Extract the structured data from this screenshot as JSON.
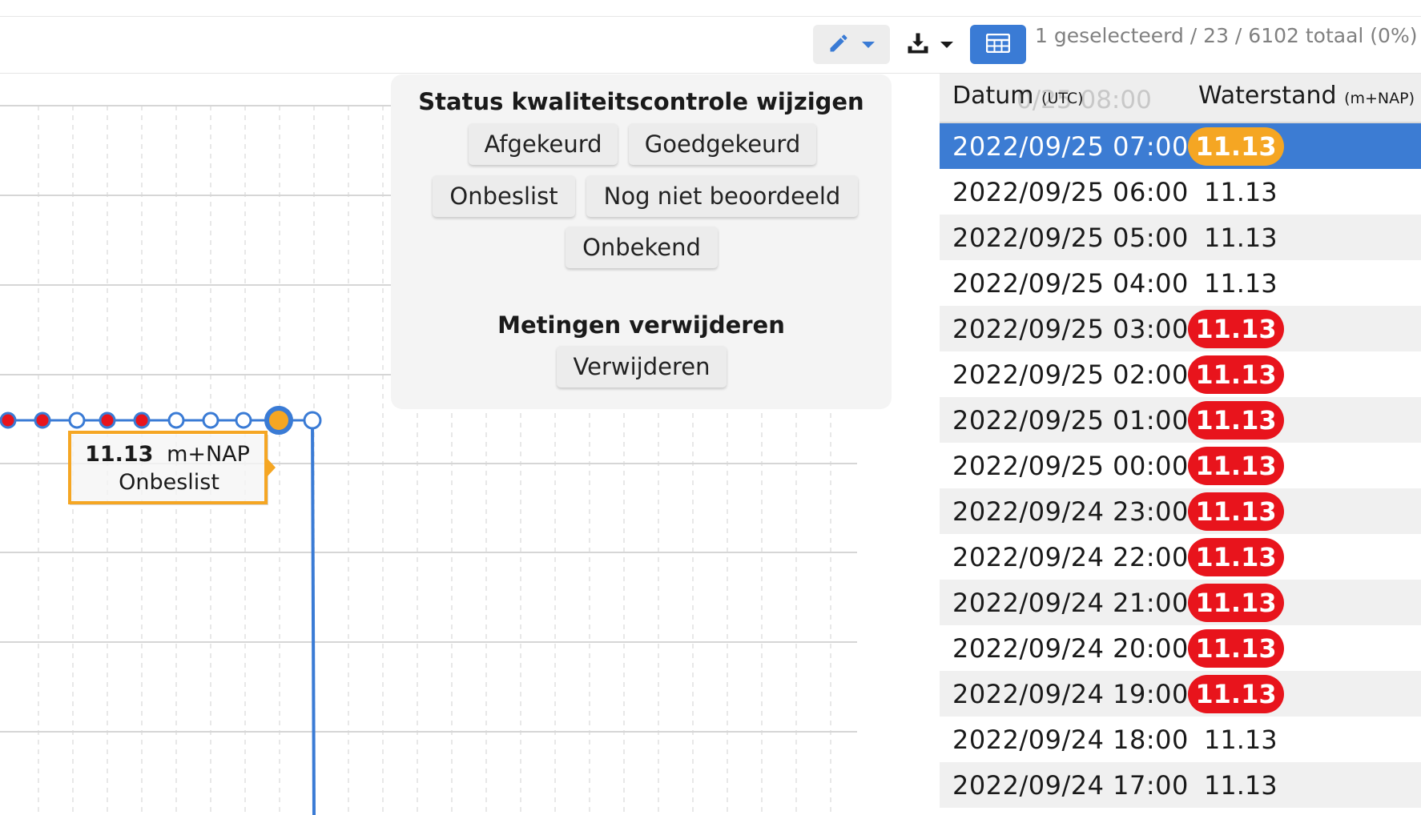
{
  "toolbar": {
    "selection_status": "1 geselecteerd / 23 / 6102 totaal (0%)",
    "edit_icon": "pencil-icon",
    "download_icon": "download-icon",
    "table_icon": "table-icon",
    "accent_color": "#3a7bd5"
  },
  "popup": {
    "status_title": "Status kwaliteitscontrole wijzigen",
    "btn_afgekeurd": "Afgekeurd",
    "btn_goedgekeurd": "Goedgekeurd",
    "btn_onbeslist": "Onbeslist",
    "btn_nog_niet": "Nog niet beoordeeld",
    "btn_onbekend": "Onbekend",
    "delete_title": "Metingen verwijderen",
    "btn_verwijderen": "Verwijderen"
  },
  "tooltip": {
    "value": "11.13",
    "unit": "m+NAP",
    "status": "Onbeslist"
  },
  "table": {
    "col_date": "Datum",
    "col_date_unit": "(UTC)",
    "col_value": "Waterstand",
    "col_value_unit": "(m+NAP)",
    "ghost_text": "0/25 08:00",
    "colors": {
      "orange": "#f5a623",
      "red": "#e8141c",
      "selected": "#3c7cd3"
    },
    "rows": [
      {
        "date": "2022/09/25 07:00",
        "value": "11.13",
        "status": "orange",
        "selected": true
      },
      {
        "date": "2022/09/25 06:00",
        "value": "11.13",
        "status": "none"
      },
      {
        "date": "2022/09/25 05:00",
        "value": "11.13",
        "status": "none"
      },
      {
        "date": "2022/09/25 04:00",
        "value": "11.13",
        "status": "none"
      },
      {
        "date": "2022/09/25 03:00",
        "value": "11.13",
        "status": "red"
      },
      {
        "date": "2022/09/25 02:00",
        "value": "11.13",
        "status": "red"
      },
      {
        "date": "2022/09/25 01:00",
        "value": "11.13",
        "status": "red"
      },
      {
        "date": "2022/09/25 00:00",
        "value": "11.13",
        "status": "red"
      },
      {
        "date": "2022/09/24 23:00",
        "value": "11.13",
        "status": "red"
      },
      {
        "date": "2022/09/24 22:00",
        "value": "11.13",
        "status": "red"
      },
      {
        "date": "2022/09/24 21:00",
        "value": "11.13",
        "status": "red"
      },
      {
        "date": "2022/09/24 20:00",
        "value": "11.13",
        "status": "red"
      },
      {
        "date": "2022/09/24 19:00",
        "value": "11.13",
        "status": "red"
      },
      {
        "date": "2022/09/24 18:00",
        "value": "11.13",
        "status": "none"
      },
      {
        "date": "2022/09/24 17:00",
        "value": "11.13",
        "status": "none"
      }
    ]
  }
}
